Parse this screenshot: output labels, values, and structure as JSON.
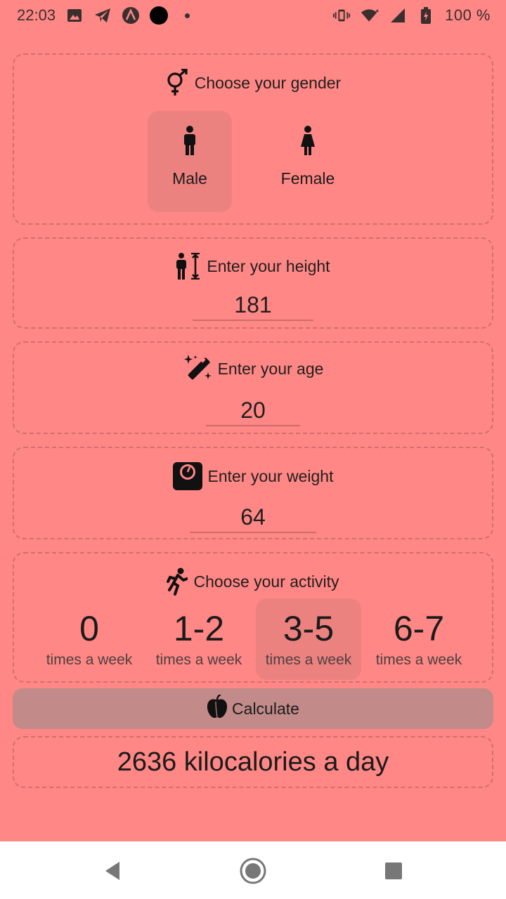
{
  "status_bar": {
    "time": "22:03",
    "battery": "100 %",
    "icons": [
      "image-icon",
      "telegram-icon",
      "arc-icon",
      "record-dot-icon",
      "more-dot-icon",
      "vibrate-icon",
      "wifi-icon",
      "signal-icon",
      "battery-icon"
    ]
  },
  "gender": {
    "title": "Choose your gender",
    "icon": "gender-icon",
    "options": [
      {
        "label": "Male",
        "icon": "male-icon",
        "selected": true
      },
      {
        "label": "Female",
        "icon": "female-icon",
        "selected": false
      }
    ]
  },
  "height": {
    "title": "Enter your height",
    "icon": "height-icon",
    "value": "181"
  },
  "age": {
    "title": "Enter your age",
    "icon": "magic-wand-icon",
    "value": "20"
  },
  "weight": {
    "title": "Enter your weight",
    "icon": "scale-icon",
    "value": "64"
  },
  "activity": {
    "title": "Choose your activity",
    "icon": "running-icon",
    "options": [
      {
        "count": "0",
        "label": "times a week",
        "selected": false
      },
      {
        "count": "1-2",
        "label": "times a week",
        "selected": false
      },
      {
        "count": "3-5",
        "label": "times a week",
        "selected": true
      },
      {
        "count": "6-7",
        "label": "times a week",
        "selected": false
      }
    ]
  },
  "calculate": {
    "label": "Calculate",
    "icon": "apple-icon"
  },
  "result": {
    "text": "2636 kilocalories a day"
  },
  "colors": {
    "background": "#ff8785",
    "selected": "#f08282",
    "button": "#c38a8a",
    "nav_bar": "#ffffff"
  }
}
